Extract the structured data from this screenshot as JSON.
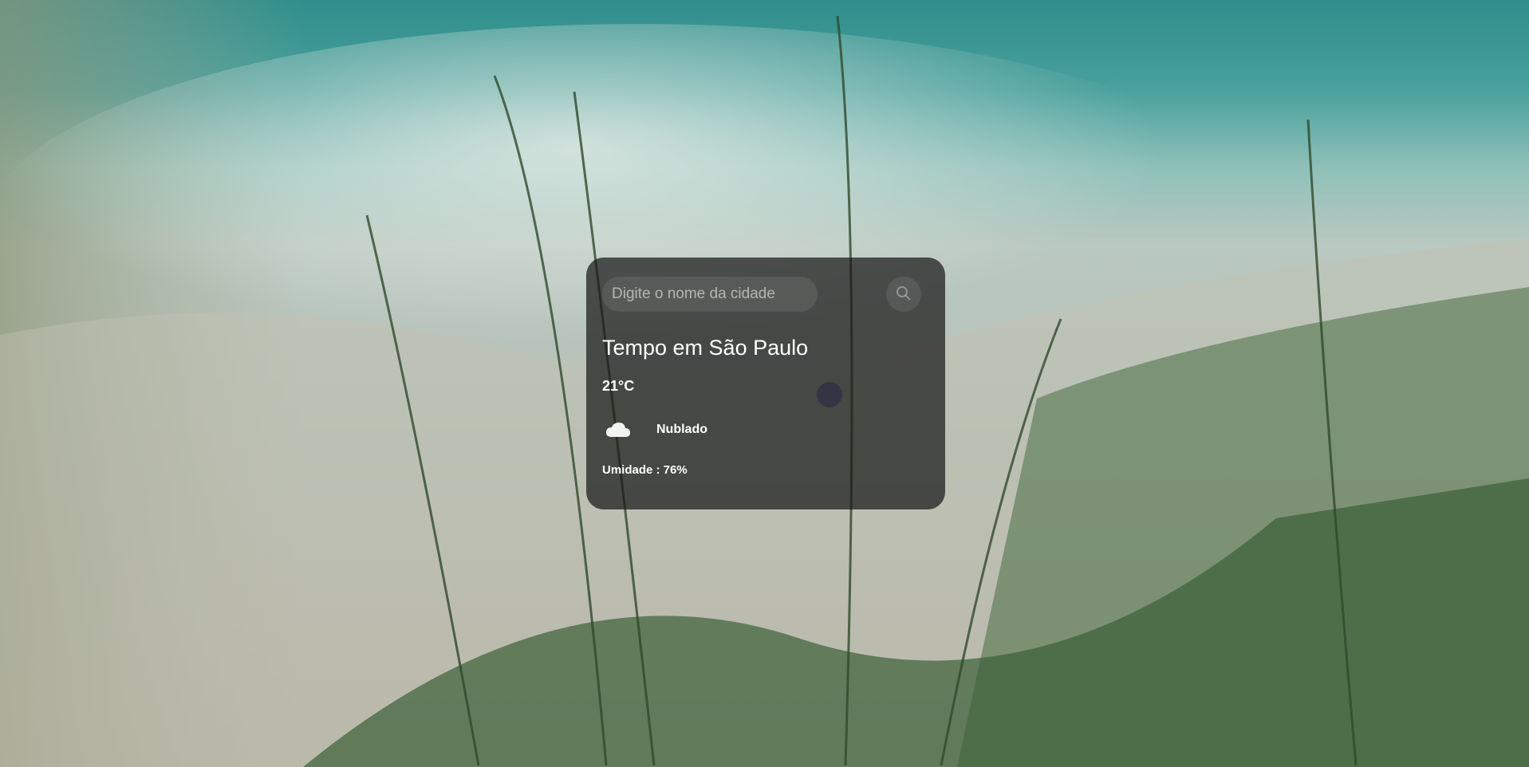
{
  "search": {
    "placeholder": "Digite o nome da cidade"
  },
  "weather": {
    "title": "Tempo em São Paulo",
    "temperature": "21°C",
    "condition": "Nublado",
    "condition_icon": "cloud-icon",
    "humidity": "Umidade : 76%"
  },
  "background": {
    "icon": "lake-grass-photo"
  }
}
